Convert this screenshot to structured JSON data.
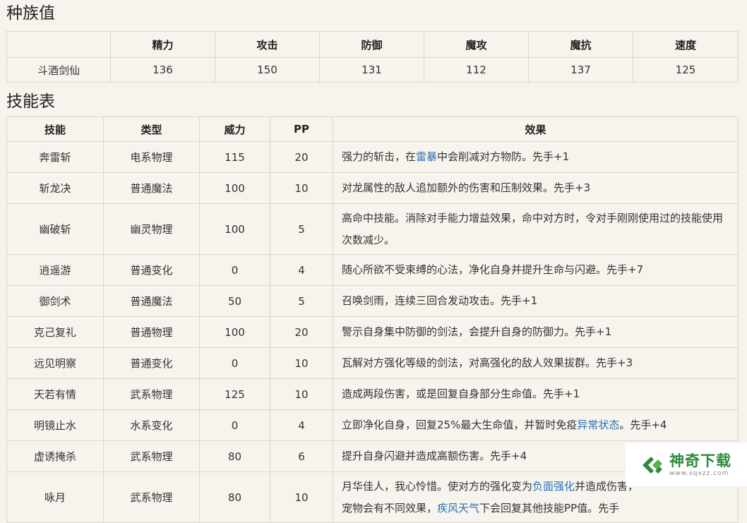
{
  "stats_section": {
    "title": "种族值",
    "headers": [
      "",
      "精力",
      "攻击",
      "防御",
      "魔攻",
      "魔抗",
      "速度"
    ],
    "row": [
      "斗酒剑仙",
      "136",
      "150",
      "131",
      "112",
      "137",
      "125"
    ]
  },
  "skills_section": {
    "title": "技能表",
    "headers": [
      "技能",
      "类型",
      "威力",
      "PP",
      "效果"
    ],
    "rows": [
      {
        "name": "奔雷斩",
        "type": "电系物理",
        "power": "115",
        "pp": "20",
        "effect_pre": "强力的斩击，在",
        "effect_link": "雷暴",
        "effect_post": "中会削减对方物防。先手+1"
      },
      {
        "name": "斩龙决",
        "type": "普通魔法",
        "power": "100",
        "pp": "10",
        "effect_pre": "对龙属性的敌人追加额外的伤害和压制效果。先手+3",
        "effect_link": "",
        "effect_post": ""
      },
      {
        "name": "幽破斩",
        "type": "幽灵物理",
        "power": "100",
        "pp": "5",
        "effect_pre": "高命中技能。消除对手能力增益效果，命中对方时，令对手刚刚使用过的技能使用次数减少。",
        "effect_link": "",
        "effect_post": ""
      },
      {
        "name": "逍遥游",
        "type": "普通变化",
        "power": "0",
        "pp": "4",
        "effect_pre": "随心所欲不受束缚的心法，净化自身并提升生命与闪避。先手+7",
        "effect_link": "",
        "effect_post": ""
      },
      {
        "name": "御剑术",
        "type": "普通魔法",
        "power": "50",
        "pp": "5",
        "effect_pre": "召唤剑雨，连续三回合发动攻击。先手+1",
        "effect_link": "",
        "effect_post": ""
      },
      {
        "name": "克己复礼",
        "type": "普通物理",
        "power": "100",
        "pp": "20",
        "effect_pre": "警示自身集中防御的剑法，会提升自身的防御力。先手+1",
        "effect_link": "",
        "effect_post": ""
      },
      {
        "name": "远见明察",
        "type": "普通变化",
        "power": "0",
        "pp": "10",
        "effect_pre": "瓦解对方强化等级的剑法，对高强化的敌人效果拔群。先手+3",
        "effect_link": "",
        "effect_post": ""
      },
      {
        "name": "天若有情",
        "type": "武系物理",
        "power": "125",
        "pp": "10",
        "effect_pre": "造成两段伤害，或是回复自身部分生命值。先手+1",
        "effect_link": "",
        "effect_post": ""
      },
      {
        "name": "明镜止水",
        "type": "水系变化",
        "power": "0",
        "pp": "4",
        "effect_pre": "立即净化自身，回复25%最大生命值，并暂时免疫",
        "effect_link": "异常状态",
        "effect_post": "。先手+4"
      },
      {
        "name": "虚诱掩杀",
        "type": "武系物理",
        "power": "80",
        "pp": "6",
        "effect_pre": "提升自身闪避并造成高额伤害。先手+4",
        "effect_link": "",
        "effect_post": ""
      }
    ],
    "last_row": {
      "name": "咏月",
      "type": "武系物理",
      "power": "80",
      "pp": "10",
      "line1_pre": "月华佳人，我心怜惜。使对方的强化变为",
      "line1_link": "负面强化",
      "line1_post": "并造成伤害，",
      "line2_pre": "宠物会有不同效果，",
      "line2_link": "疾风天气",
      "line2_post": "下会回复其他技能PP值。先手"
    }
  },
  "watermark": {
    "brand": "神奇下载",
    "url": "www.sqxzz.com",
    "icon": "leaf-logo-icon",
    "color": "#2e8b3e"
  }
}
